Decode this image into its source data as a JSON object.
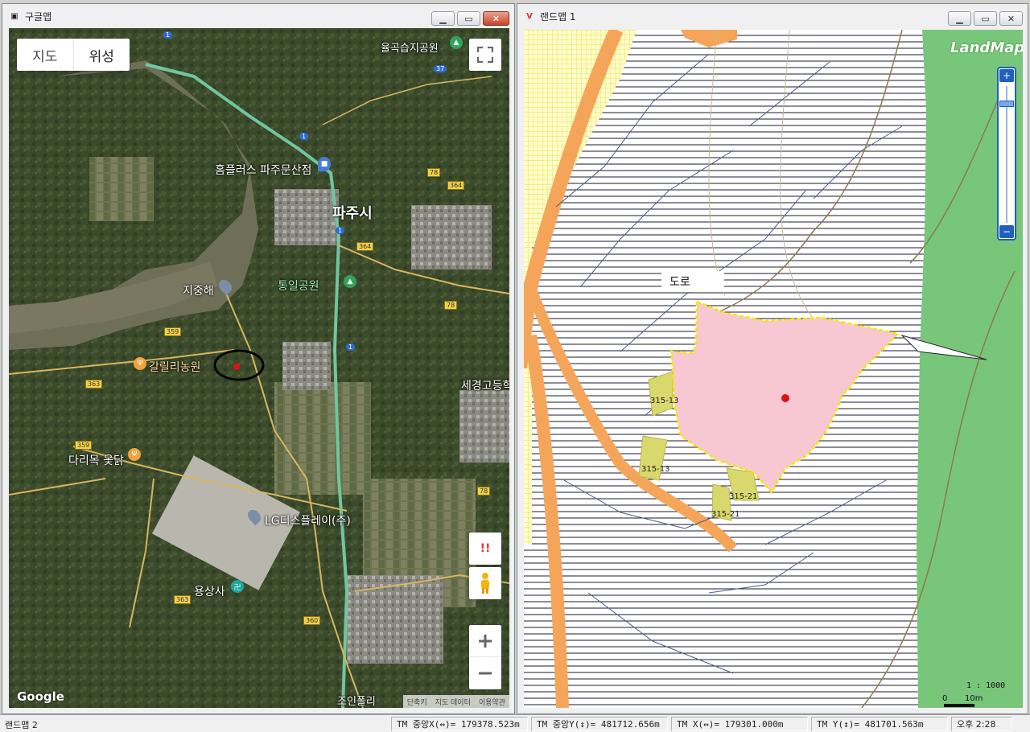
{
  "left_window": {
    "title": "구글맵",
    "map_type_buttons": [
      "지도",
      "위성"
    ],
    "place_labels": {
      "yulgok": "율곡습지공원",
      "homeplus": "홈플러스 파주문산점",
      "paju": "파주시",
      "jijunghae": "지중해",
      "tongil": "통일공원",
      "galili": "갈릴리농원",
      "darimok": "다리목 옻닭",
      "lgd": "LG디스플레이(주)",
      "yongsang": "용상사",
      "sekyung": "세경고등학",
      "joinpoli": "조인폴리"
    },
    "road_numbers": [
      "1",
      "37",
      "78",
      "364",
      "364",
      "359",
      "363",
      "359",
      "78",
      "78",
      "363",
      "360",
      "1",
      "1",
      "1"
    ],
    "attribution": [
      "단축키",
      "지도 데이터",
      "이용약관"
    ],
    "google_logo": "Google",
    "control_icons": [
      "fullscreen-icon",
      "alert-icon",
      "pegman-icon",
      "zoom-in-icon",
      "zoom-out-icon"
    ],
    "alert_glyph": "!!"
  },
  "right_window": {
    "title": "랜드맵 1",
    "logo": "LandMap",
    "road_label": "도로",
    "parcel_labels": [
      "315-13",
      "315-13",
      "315-21",
      "315-21"
    ],
    "scale_ratio": "1 : 1000",
    "scale_ticks": [
      "0",
      "10m"
    ],
    "zoom_icons": [
      "zoom-in-icon",
      "zoom-out-icon"
    ]
  },
  "status_bar": {
    "app": "랜드맵 2",
    "tm_center_x": "TM 중앙X(↔)= 179378.523m",
    "tm_center_y": "TM 중앙Y(↕)= 481712.656m",
    "tm_x": "TM X(↔)= 179301.000m",
    "tm_y": "TM Y(↕)= 481701.563m",
    "clock": "오후 2:28"
  },
  "colors": {
    "satellite_base": "#3d4a2c",
    "river": "#6f6f58",
    "parcel_pink": "#f8c8d2",
    "parcel_border": "#f5e600",
    "road_orange": "#f5a55a",
    "green_area": "#78c67a",
    "marker_red": "#e01010"
  }
}
